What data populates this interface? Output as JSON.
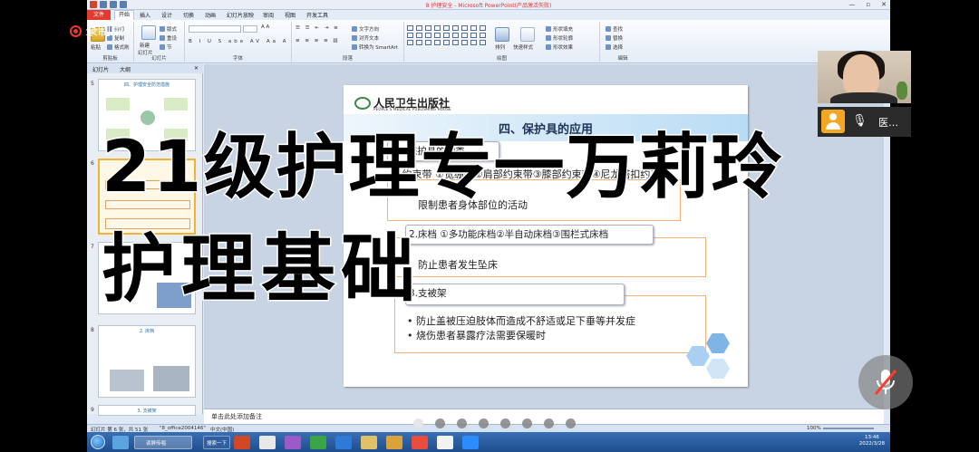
{
  "window": {
    "title": "8 护理安全 - Microsoft PowerPoint(产品激活失败)"
  },
  "ribbon_tabs": {
    "file": "文件",
    "items": [
      "开始",
      "插入",
      "设计",
      "切换",
      "动画",
      "幻灯片放映",
      "审阅",
      "视图",
      "开发工具"
    ]
  },
  "ribbon": {
    "clipboard": {
      "paste": "粘贴",
      "cut": "剪切",
      "copy": "复制",
      "format_painter": "格式刷",
      "label": "剪贴板"
    },
    "slides": {
      "new_slide": "新建",
      "new_slide2": "幻灯片",
      "layout": "版式",
      "reset": "重设",
      "section": "节",
      "label": "幻灯片"
    },
    "font": {
      "label": "字体"
    },
    "paragraph": {
      "text_direction": "文字方向",
      "align_text": "对齐文本",
      "smartart": "转换为 SmartArt",
      "label": "段落"
    },
    "drawing": {
      "arrange": "排列",
      "quick_styles": "快速样式",
      "shape_fill": "形状填充",
      "shape_outline": "形状轮廓",
      "shape_effects": "形状效果",
      "label": "绘图"
    },
    "editing": {
      "find": "查找",
      "replace": "替换",
      "select": "选择",
      "label": "编辑"
    }
  },
  "pane": {
    "tabs": [
      "幻灯片",
      "大纲"
    ],
    "thumbnails": [
      {
        "num": "5",
        "title": "四、护理安全防范措施"
      },
      {
        "num": "6",
        "title": ""
      },
      {
        "num": "7",
        "title": "1. 约束带"
      },
      {
        "num": "8",
        "title": "2. 床档"
      },
      {
        "num": "9",
        "title": "3. 支被架"
      }
    ]
  },
  "slide": {
    "publisher_cn": "人民卫生出版社",
    "publisher_en": "PEOPLE'S MEDICAL PUBLISHING HOUSE",
    "title": "四、保护具的应用",
    "sec1_label": "(一)保护具的种类",
    "sec1_line1": "1.约束带 ①宽绷带②肩部约束带③膝部约束带④尼龙搭扣约束带",
    "sec1_text": "限制患者身体部位的活动",
    "sec2_label": "2.床档 ①多功能床档②半自动床档③围栏式床档",
    "sec2_text": "防止患者发生坠床",
    "sec3_label": "3.支被架",
    "sec3_bullets": [
      "防止盖被压迫肢体而造成不舒适或足下垂等并发症",
      "烧伤患者暴露疗法需要保暖时"
    ]
  },
  "notes": "单击此处添加备注",
  "status": {
    "slide_info": "幻灯片 第 6 张，共 51 张",
    "theme": "\"8_office2004146\"",
    "lang": "中文(中国)",
    "zoom": "100%"
  },
  "taskbar": {
    "task1": "读屏传唱",
    "task2": "搜索一下",
    "time": "13:46",
    "date": "2022/3/28"
  },
  "overlay": {
    "recording": "录制中",
    "big_title": "21级护理专一万莉玲",
    "big_subtitle": "护理基础",
    "participant_name": "医…",
    "page_dots": 8,
    "active_dot": 0
  }
}
